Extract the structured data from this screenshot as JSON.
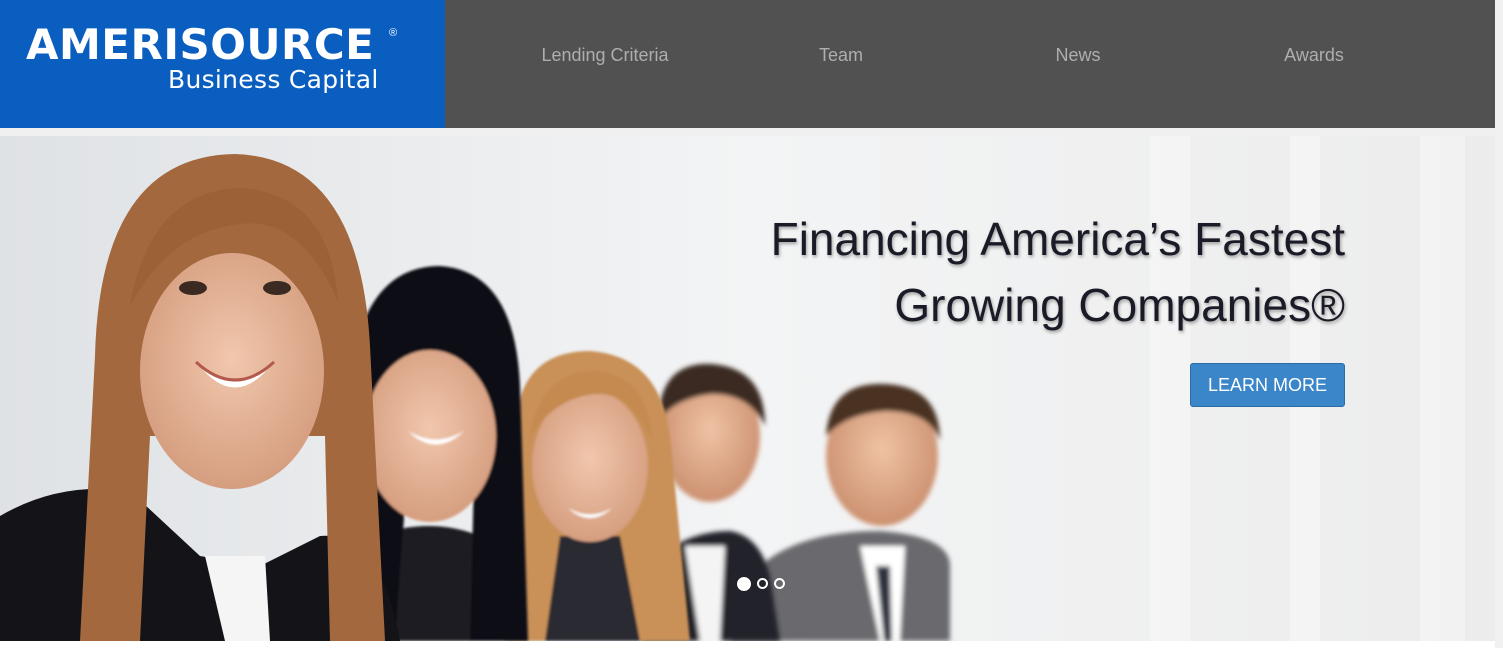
{
  "brand": {
    "name": "AMERISOURCE",
    "registered_mark": "®",
    "tagline": "Business Capital",
    "color": "#0a5ebf"
  },
  "nav": {
    "items": [
      {
        "label": "Lending Criteria"
      },
      {
        "label": "Team"
      },
      {
        "label": "News"
      },
      {
        "label": "Awards"
      }
    ],
    "background": "#515151",
    "text_color": "#aeaeae"
  },
  "hero": {
    "headline_line1": "Financing America’s Fastest",
    "headline_line2": "Growing Companies®",
    "cta_label": "LEARN MORE",
    "cta_color": "#3a86c8",
    "photo": "group-of-smiling-business-people",
    "slides": {
      "count": 3,
      "active_index": 0
    }
  }
}
